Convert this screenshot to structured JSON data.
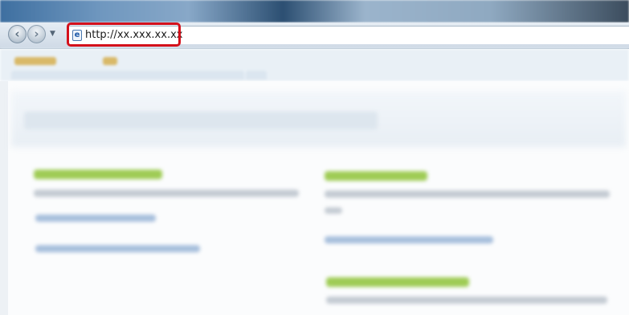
{
  "browser": {
    "address_bar": {
      "url": "http://xx.xxx.xx.xx"
    },
    "nav": {
      "back_icon": "back-arrow-icon",
      "forward_icon": "forward-arrow-icon",
      "dropdown_icon": "chevron-down-icon",
      "page_icon": "ie-page-icon"
    },
    "highlight_color": "#d4101b"
  },
  "page": {
    "note": ""
  },
  "colors": {
    "link_green": "#9fcc55",
    "link_blue": "#a7bfdc",
    "text_gray": "#c4cbd3"
  }
}
